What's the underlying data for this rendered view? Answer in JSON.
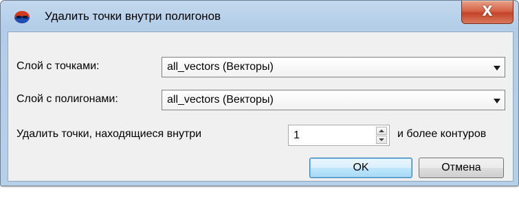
{
  "window": {
    "title": "Удалить точки внутри полигонов",
    "close_label": "X"
  },
  "form": {
    "points_layer_label": "Слой с точками:",
    "points_layer_value": "all_vectors (Векторы)",
    "polygons_layer_label": "Слой с полигонами:",
    "polygons_layer_value": "all_vectors (Векторы)",
    "delete_prefix": "Удалить точки, находящиеся внутри",
    "count_value": "1",
    "delete_suffix": "и более контуров"
  },
  "buttons": {
    "ok": "OK",
    "cancel": "Отмена"
  }
}
